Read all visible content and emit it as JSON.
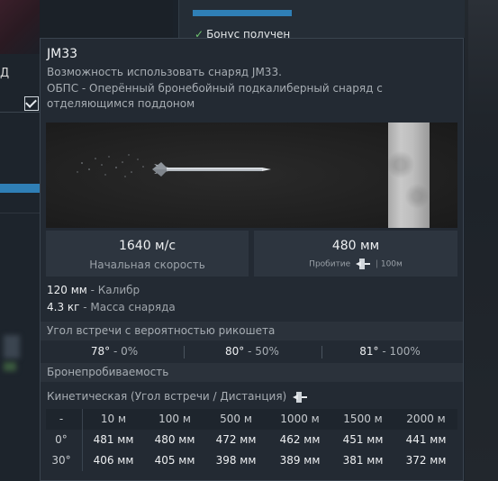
{
  "background": {
    "left_letter": "Д",
    "bonus_text": "Бонус получен"
  },
  "tooltip": {
    "title": "JM33",
    "desc_lines": [
      "Возможность использовать снаряд JM33.",
      "ОБПС - Оперённый бронебойный подкалиберный снаряд с",
      "отделяющимся поддоном"
    ],
    "velocity": {
      "value": "1640 м/с",
      "label": "Начальная скорость"
    },
    "penetration": {
      "value": "480 мм",
      "label": "Пробитие",
      "distance": "100м"
    },
    "caliber": {
      "value": "120 мм",
      "label": " - Калибр"
    },
    "mass": {
      "value": "4.3 кг",
      "label": " - Масса снаряда"
    },
    "ricochet": {
      "title": "Угол встречи с вероятностью рикошета",
      "items": [
        {
          "angle": "78°",
          "prob": " - 0%"
        },
        {
          "angle": "80°",
          "prob": " - 50%"
        },
        {
          "angle": "81°",
          "prob": " - 100%"
        }
      ]
    },
    "armor_pen_title": "Бронепробиваемость",
    "kinetic_label": "Кинетическая (Угол встречи / Дистанция)",
    "table": {
      "corner": "-",
      "distances": [
        "10 м",
        "100 м",
        "500 м",
        "1000 м",
        "1500 м",
        "2000 м"
      ],
      "rows": [
        {
          "angle": "0°",
          "values": [
            "481 мм",
            "480 мм",
            "472 мм",
            "462 мм",
            "451 мм",
            "441 мм"
          ]
        },
        {
          "angle": "30°",
          "values": [
            "406 мм",
            "405 мм",
            "398 мм",
            "389 мм",
            "381 мм",
            "372 мм"
          ]
        }
      ]
    }
  },
  "colors": {
    "accent_blue": "#2f7fb6",
    "check_green": "#6fc36f",
    "tooltip_bg": "#232a33"
  },
  "icons": [
    "checkmark-icon",
    "penetration-icon",
    "checkbox-icon"
  ]
}
